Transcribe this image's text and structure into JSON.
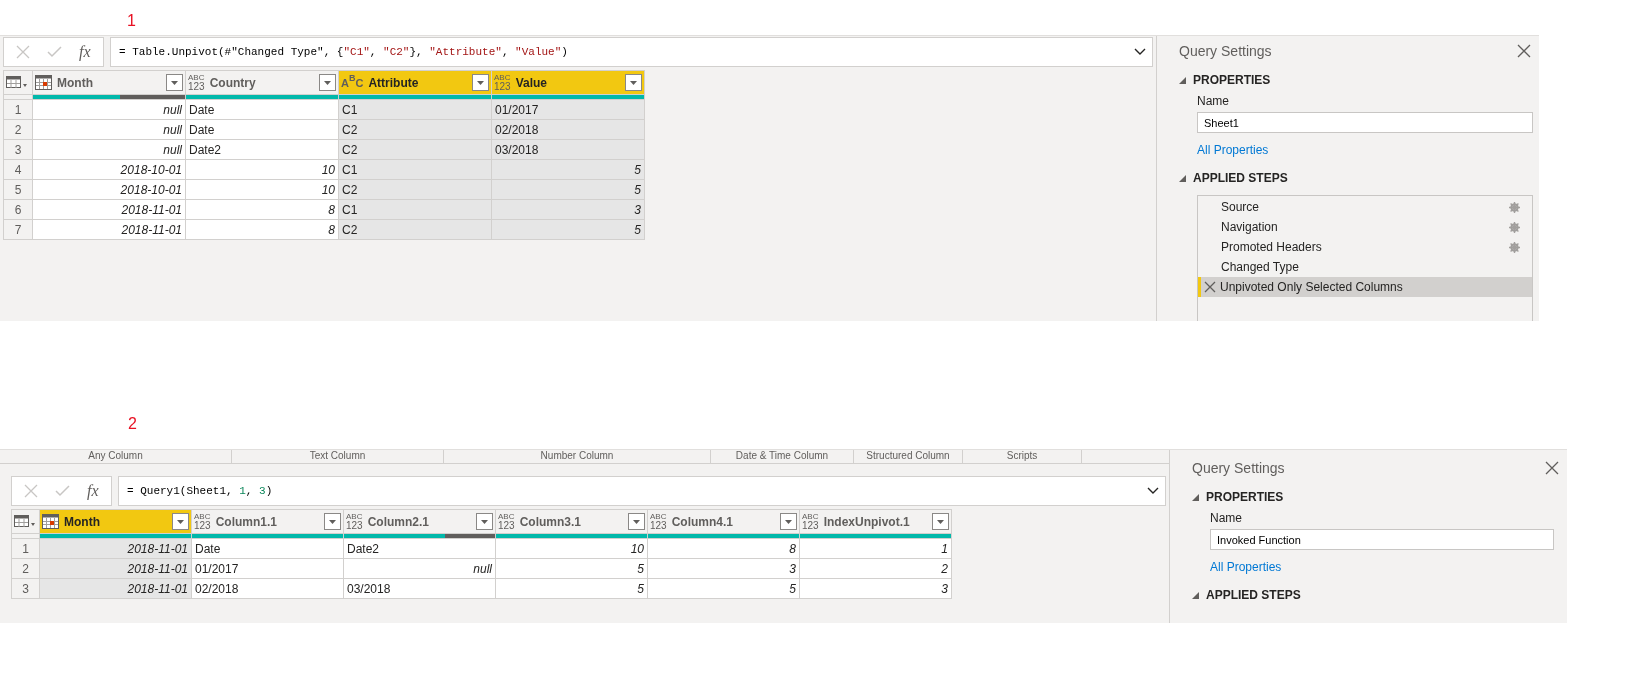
{
  "panels": [
    {
      "marker": "1",
      "formula": [
        {
          "text": "= Table.Unpivot(#\"Changed Type\", {",
          "kind": "plain"
        },
        {
          "text": "\"C1\"",
          "kind": "string"
        },
        {
          "text": ", ",
          "kind": "plain"
        },
        {
          "text": "\"C2\"",
          "kind": "string"
        },
        {
          "text": "}, ",
          "kind": "plain"
        },
        {
          "text": "\"Attribute\"",
          "kind": "string"
        },
        {
          "text": ", ",
          "kind": "plain"
        },
        {
          "text": "\"Value\"",
          "kind": "string"
        },
        {
          "text": ")",
          "kind": "plain"
        }
      ],
      "fx": "fx",
      "columns": [
        {
          "name": "Month",
          "kind": "date",
          "selected": false,
          "quality": {
            "level": 0.57
          }
        },
        {
          "name": "Country",
          "kind": "any",
          "type_label": [
            "ABC",
            "123"
          ],
          "selected": false,
          "quality": {
            "level": 1
          }
        },
        {
          "name": "Attribute",
          "kind": "text",
          "type_label": [
            "A",
            "B",
            "C"
          ],
          "selected": true,
          "quality": {
            "level": 1
          }
        },
        {
          "name": "Value",
          "kind": "any",
          "type_label": [
            "ABC",
            "123"
          ],
          "selected": true,
          "quality": {
            "level": 1
          }
        }
      ],
      "rows": [
        {
          "number": "1",
          "cells": [
            {
              "text": "null",
              "kind": "value"
            },
            {
              "text": "Date",
              "kind": "text"
            },
            {
              "text": "C1",
              "kind": "text"
            },
            {
              "text": "01/2017",
              "kind": "text"
            }
          ]
        },
        {
          "number": "2",
          "cells": [
            {
              "text": "null",
              "kind": "value"
            },
            {
              "text": "Date",
              "kind": "text"
            },
            {
              "text": "C2",
              "kind": "text"
            },
            {
              "text": "02/2018",
              "kind": "text"
            }
          ]
        },
        {
          "number": "3",
          "cells": [
            {
              "text": "null",
              "kind": "value"
            },
            {
              "text": "Date2",
              "kind": "text"
            },
            {
              "text": "C2",
              "kind": "text"
            },
            {
              "text": "03/2018",
              "kind": "text"
            }
          ]
        },
        {
          "number": "4",
          "cells": [
            {
              "text": "2018-10-01",
              "kind": "value"
            },
            {
              "text": "10",
              "kind": "value"
            },
            {
              "text": "C1",
              "kind": "text"
            },
            {
              "text": "5",
              "kind": "value"
            }
          ]
        },
        {
          "number": "5",
          "cells": [
            {
              "text": "2018-10-01",
              "kind": "value"
            },
            {
              "text": "10",
              "kind": "value"
            },
            {
              "text": "C2",
              "kind": "text"
            },
            {
              "text": "5",
              "kind": "value"
            }
          ]
        },
        {
          "number": "6",
          "cells": [
            {
              "text": "2018-11-01",
              "kind": "value"
            },
            {
              "text": "8",
              "kind": "value"
            },
            {
              "text": "C1",
              "kind": "text"
            },
            {
              "text": "3",
              "kind": "value"
            }
          ]
        },
        {
          "number": "7",
          "cells": [
            {
              "text": "2018-11-01",
              "kind": "value"
            },
            {
              "text": "8",
              "kind": "value"
            },
            {
              "text": "C2",
              "kind": "text"
            },
            {
              "text": "5",
              "kind": "value"
            }
          ]
        }
      ],
      "settings": {
        "title": "Query Settings",
        "properties_heading": "PROPERTIES",
        "name_label": "Name",
        "name_value": "Sheet1",
        "all_properties": "All Properties",
        "steps_heading": "APPLIED STEPS",
        "steps": [
          {
            "label": "Source",
            "has_settings": true,
            "selected": false
          },
          {
            "label": "Navigation",
            "has_settings": true,
            "selected": false
          },
          {
            "label": "Promoted Headers",
            "has_settings": true,
            "selected": false
          },
          {
            "label": "Changed Type",
            "has_settings": false,
            "selected": false
          },
          {
            "label": "Unpivoted Only Selected Columns",
            "has_settings": false,
            "selected": true
          }
        ]
      }
    },
    {
      "marker": "2",
      "ribbon_groups": [
        "Any Column",
        "Text Column",
        "Number Column",
        "Date & Time Column",
        "Structured Column",
        "Scripts"
      ],
      "formula": [
        {
          "text": "= Query1(Sheet1, ",
          "kind": "plain"
        },
        {
          "text": "1",
          "kind": "number"
        },
        {
          "text": ", ",
          "kind": "plain"
        },
        {
          "text": "3",
          "kind": "number"
        },
        {
          "text": ")",
          "kind": "plain"
        }
      ],
      "fx": "fx",
      "columns": [
        {
          "name": "Month",
          "kind": "date",
          "selected": true,
          "quality": {
            "level": 1
          }
        },
        {
          "name": "Column1.1",
          "kind": "any",
          "type_label": [
            "ABC",
            "123"
          ],
          "selected": false,
          "quality": {
            "level": 1
          }
        },
        {
          "name": "Column2.1",
          "kind": "any",
          "type_label": [
            "ABC",
            "123"
          ],
          "selected": false,
          "quality": {
            "level": 0.67
          }
        },
        {
          "name": "Column3.1",
          "kind": "any",
          "type_label": [
            "ABC",
            "123"
          ],
          "selected": false,
          "quality": {
            "level": 1
          }
        },
        {
          "name": "Column4.1",
          "kind": "any",
          "type_label": [
            "ABC",
            "123"
          ],
          "selected": false,
          "quality": {
            "level": 1
          }
        },
        {
          "name": "IndexUnpivot.1",
          "kind": "any",
          "type_label": [
            "ABC",
            "123"
          ],
          "selected": false,
          "quality": {
            "level": 1
          }
        }
      ],
      "rows": [
        {
          "number": "1",
          "cells": [
            {
              "text": "2018-11-01",
              "kind": "value"
            },
            {
              "text": "Date",
              "kind": "text"
            },
            {
              "text": "Date2",
              "kind": "text"
            },
            {
              "text": "10",
              "kind": "value"
            },
            {
              "text": "8",
              "kind": "value"
            },
            {
              "text": "1",
              "kind": "value"
            }
          ]
        },
        {
          "number": "2",
          "cells": [
            {
              "text": "2018-11-01",
              "kind": "value"
            },
            {
              "text": "01/2017",
              "kind": "text"
            },
            {
              "text": "null",
              "kind": "value"
            },
            {
              "text": "5",
              "kind": "value"
            },
            {
              "text": "3",
              "kind": "value"
            },
            {
              "text": "2",
              "kind": "value"
            }
          ]
        },
        {
          "number": "3",
          "cells": [
            {
              "text": "2018-11-01",
              "kind": "value"
            },
            {
              "text": "02/2018",
              "kind": "text"
            },
            {
              "text": "03/2018",
              "kind": "text"
            },
            {
              "text": "5",
              "kind": "value"
            },
            {
              "text": "5",
              "kind": "value"
            },
            {
              "text": "3",
              "kind": "value"
            }
          ]
        }
      ],
      "settings": {
        "title": "Query Settings",
        "properties_heading": "PROPERTIES",
        "name_label": "Name",
        "name_value": "Invoked Function",
        "all_properties": "All Properties",
        "steps_heading": "APPLIED STEPS"
      }
    }
  ]
}
